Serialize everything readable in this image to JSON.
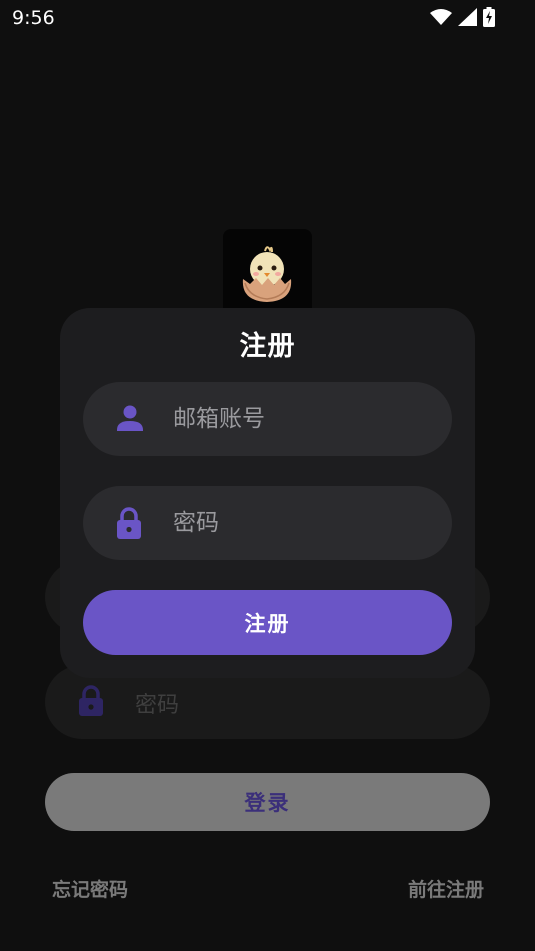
{
  "status_bar": {
    "time": "9:56",
    "icons": [
      "wifi-icon",
      "signal-icon",
      "battery-charging-icon"
    ]
  },
  "login_screen": {
    "password_placeholder": "密码",
    "login_label": "登录",
    "forgot_password_label": "忘记密码",
    "go_register_label": "前往注册"
  },
  "logo": {
    "icon": "hatching-chick-icon"
  },
  "register_dialog": {
    "title": "注册",
    "email_placeholder": "邮箱账号",
    "email_value": "",
    "password_placeholder": "密码",
    "password_value": "",
    "submit_label": "注册",
    "email_icon": "person-icon",
    "password_icon": "lock-icon"
  },
  "colors": {
    "background": "#0f0f0f",
    "dialog": "#1d1d1f",
    "field": "#2b2b2e",
    "accent": "#6a55c6",
    "muted_button": "#7a7a7a"
  }
}
